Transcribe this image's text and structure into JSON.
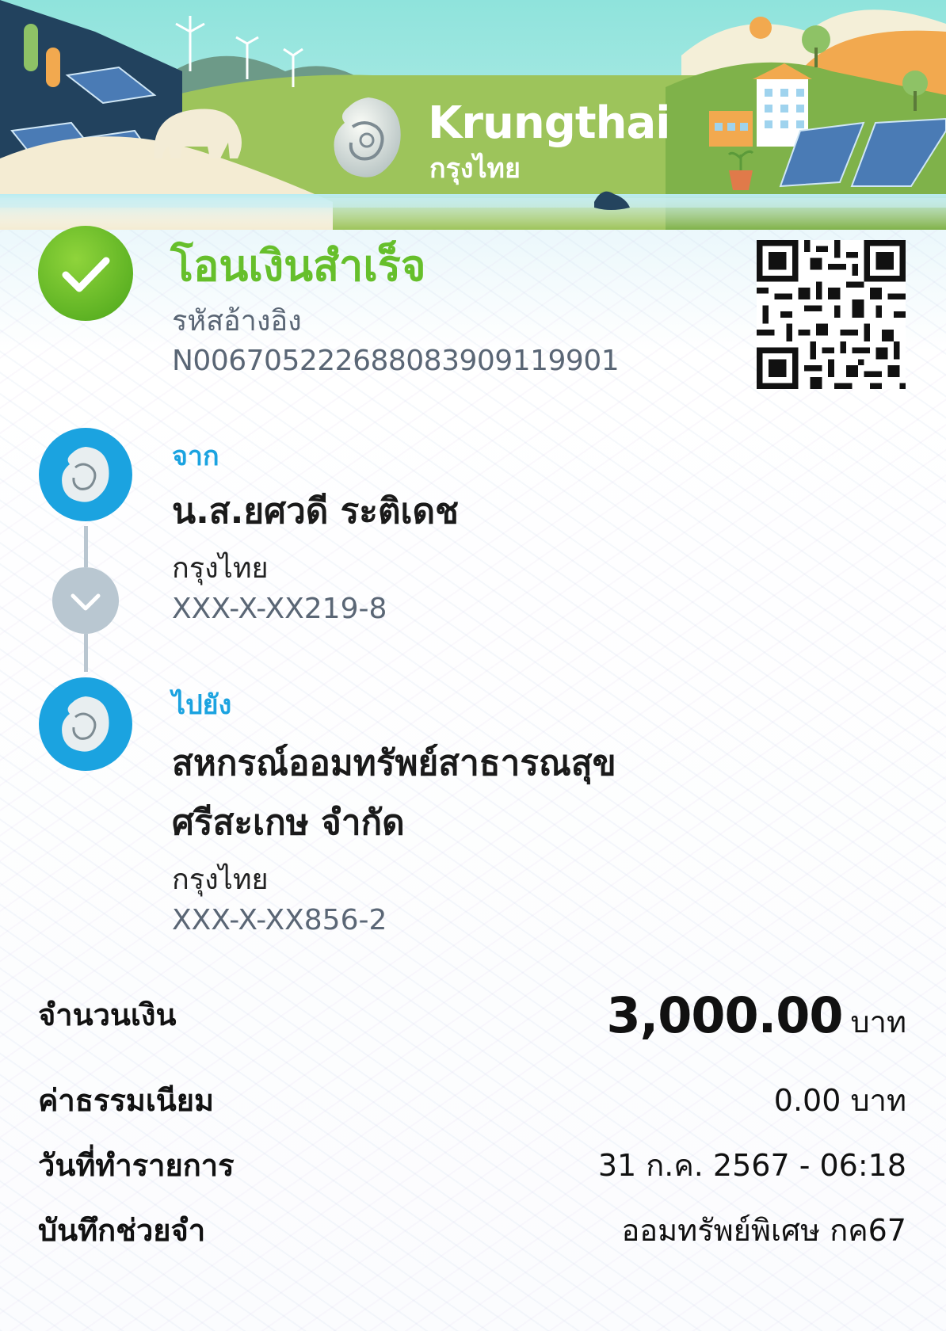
{
  "header": {
    "brand_en": "Krungthai",
    "brand_th": "กรุงไทย"
  },
  "status": {
    "title": "โอนเงินสำเร็จ",
    "ref_label": "รหัสอ้างอิง",
    "ref_value": "N006705222688083909119901",
    "icon": "check-icon",
    "color": "#66bf2b"
  },
  "from": {
    "label": "จาก",
    "name": "น.ส.ยศวดี ระติเดช",
    "bank": "กรุงไทย",
    "account": "XXX-X-XX219-8"
  },
  "to": {
    "label": "ไปยัง",
    "name_line1": "สหกรณ์ออมทรัพย์สาธารณสุข",
    "name_line2": "ศรีสะเกษ จำกัด",
    "bank": "กรุงไทย",
    "account": "XXX-X-XX856-2"
  },
  "details": {
    "amount_label": "จำนวนเงิน",
    "amount_value": "3,000.00",
    "amount_unit": "บาท",
    "fee_label": "ค่าธรรมเนียม",
    "fee_value": "0.00 บาท",
    "date_label": "วันที่ทำรายการ",
    "date_value": "31 ก.ค. 2567 - 06:18",
    "memo_label": "บันทึกช่วยจำ",
    "memo_value": "ออมทรัพย์พิเศษ กค67"
  },
  "colors": {
    "accent_blue": "#1ba3e0",
    "success_green": "#66bf2b",
    "banner_sky": "#8fe3dc"
  }
}
